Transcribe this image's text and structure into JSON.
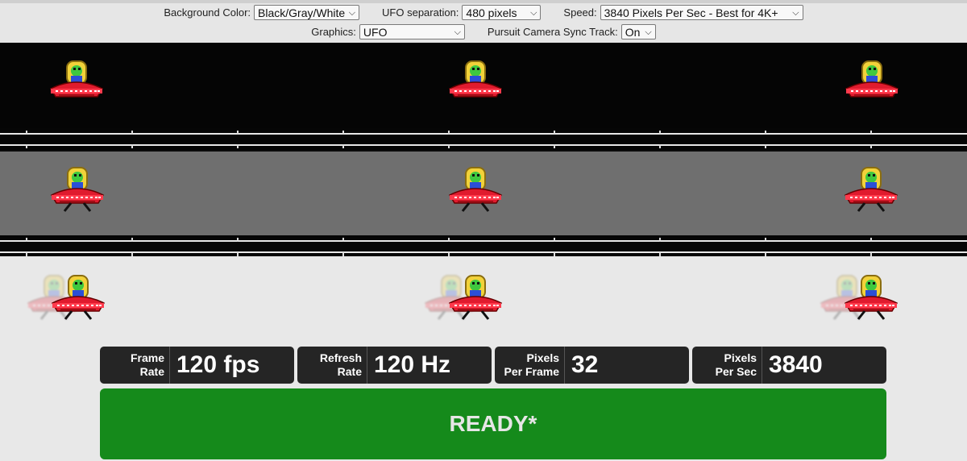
{
  "controls": {
    "background_color": {
      "label": "Background Color:",
      "value": "Black/Gray/White"
    },
    "ufo_separation": {
      "label": "UFO separation:",
      "value": "480 pixels"
    },
    "speed": {
      "label": "Speed:",
      "value": "3840 Pixels Per Sec - Best for 4K+"
    },
    "graphics": {
      "label": "Graphics:",
      "value": "UFO"
    },
    "sync_track": {
      "label": "Pursuit Camera Sync Track:",
      "value": "On"
    }
  },
  "stats": {
    "frame_rate": {
      "label_line1": "Frame",
      "label_line2": "Rate",
      "value": "120 fps"
    },
    "refresh_rate": {
      "label_line1": "Refresh",
      "label_line2": "Rate",
      "value": "120 Hz"
    },
    "pixels_per_frame": {
      "label_line1": "Pixels",
      "label_line2": "Per Frame",
      "value": "32"
    },
    "pixels_per_sec": {
      "label_line1": "Pixels",
      "label_line2": "Per Sec",
      "value": "3840"
    }
  },
  "status": {
    "text": "READY*"
  },
  "colors": {
    "ready_green": "#158a1b",
    "ufo_red": "#e01b2e",
    "alien_green": "#3fc83f"
  },
  "icons": [
    "ufo-icon",
    "chevron-down-icon"
  ]
}
